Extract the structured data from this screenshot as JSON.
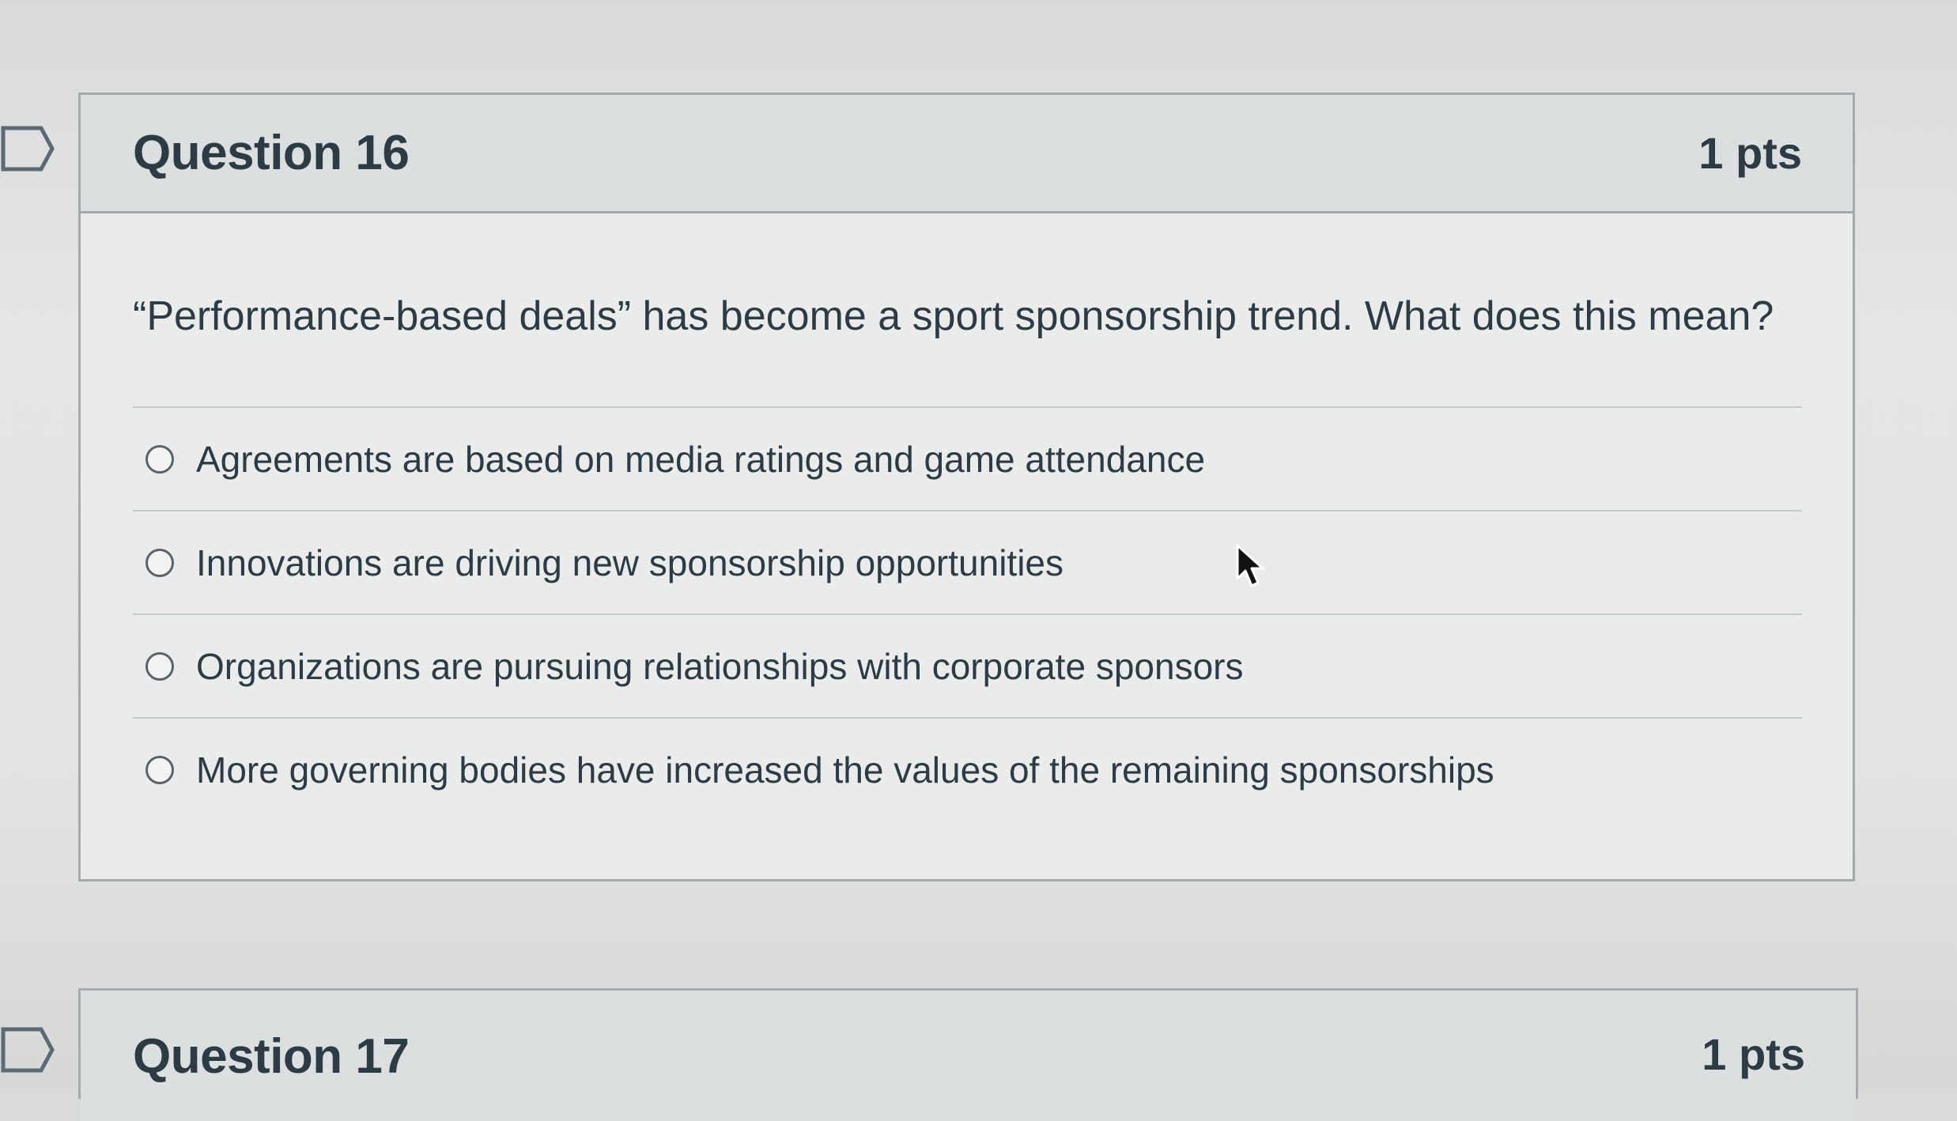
{
  "questions": [
    {
      "title": "Question 16",
      "points": "1 pts",
      "prompt": "“Performance-based deals” has become a sport sponsorship trend. What does this mean?",
      "answers": [
        {
          "label": "Agreements are based on media ratings and game attendance",
          "selected": false
        },
        {
          "label": "Innovations are driving new sponsorship opportunities",
          "selected": false
        },
        {
          "label": "Organizations are pursuing relationships with corporate sponsors",
          "selected": false
        },
        {
          "label": "More governing bodies have increased the values of the remaining sponsorships",
          "selected": false
        }
      ]
    },
    {
      "title": "Question 17",
      "points": "1 pts"
    }
  ],
  "icons": {
    "flag": "bookmark-flag-icon",
    "cursor": "mouse-pointer-icon"
  },
  "colors": {
    "text": "#2d3b45",
    "border": "#a6aaad",
    "header_bg": "#dcdfdf",
    "body_bg": "#eaecec"
  }
}
